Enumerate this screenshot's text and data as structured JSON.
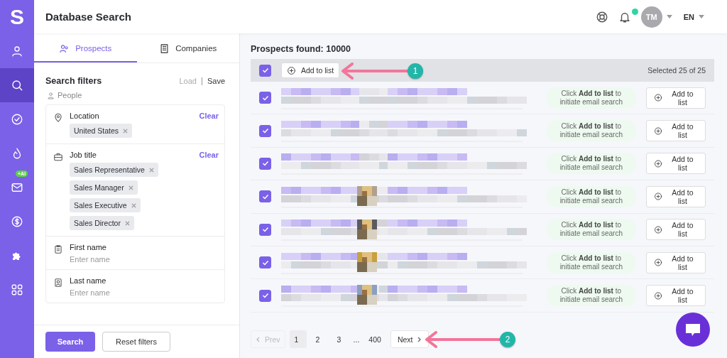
{
  "sidebar": {
    "logo": "S",
    "items": [
      {
        "selected": false
      },
      {
        "selected": true
      },
      {
        "selected": false
      },
      {
        "selected": false
      },
      {
        "selected": false,
        "badge": "+AI"
      },
      {
        "selected": false
      },
      {
        "selected": false
      },
      {
        "selected": false
      }
    ]
  },
  "header": {
    "title": "Database Search",
    "notification": true,
    "avatar": "TM",
    "language": "EN"
  },
  "tabs": [
    {
      "label": "Prospects",
      "selected": true
    },
    {
      "label": "Companies",
      "selected": false
    }
  ],
  "filters": {
    "title": "Search filters",
    "load": "Load",
    "save": "Save",
    "group": "People",
    "sections": [
      {
        "label": "Location",
        "clear": "Clear",
        "chips": [
          "United States"
        ]
      },
      {
        "label": "Job title",
        "clear": "Clear",
        "chips": [
          "Sales Representative",
          "Sales Manager",
          "Sales Executive",
          "Sales Director"
        ]
      },
      {
        "label": "First name",
        "placeholder": "Enter name"
      },
      {
        "label": "Last name",
        "placeholder": "Enter name"
      }
    ],
    "search_button": "Search",
    "reset_button": "Reset filters"
  },
  "results": {
    "title": "Prospects found: 10000",
    "all_checked": true,
    "bulk_button": "Add to list",
    "selected_count": "Selected 25 of 25",
    "rows": [
      {
        "checked": true,
        "photo": false,
        "hint": "Click **Add to list** to initiate email search",
        "button": "Add to list"
      },
      {
        "checked": true,
        "photo": false,
        "hint": "Click **Add to list** to initiate email search",
        "button": "Add to list"
      },
      {
        "checked": true,
        "photo": false,
        "hint": "Click **Add to list** to initiate email search",
        "button": "Add to list"
      },
      {
        "checked": true,
        "photo": true,
        "hint": "Click **Add to list** to initiate email search",
        "button": "Add to list"
      },
      {
        "checked": true,
        "photo": true,
        "hint": "Click **Add to list** to initiate email search",
        "button": "Add to list"
      },
      {
        "checked": true,
        "photo": true,
        "hint": "Click **Add to list** to initiate email search",
        "button": "Add to list"
      },
      {
        "checked": true,
        "photo": true,
        "hint": "Click **Add to list** to initiate email search",
        "button": "Add to list"
      }
    ],
    "pagination": {
      "prev": "Prev",
      "pages": [
        {
          "label": "1",
          "selected": true
        },
        {
          "label": "2",
          "selected": false
        },
        {
          "label": "3",
          "selected": false
        }
      ],
      "ellipsis": "...",
      "last": "400",
      "next": "Next"
    }
  },
  "annotations": [
    {
      "label": "1"
    },
    {
      "label": "2"
    }
  ]
}
